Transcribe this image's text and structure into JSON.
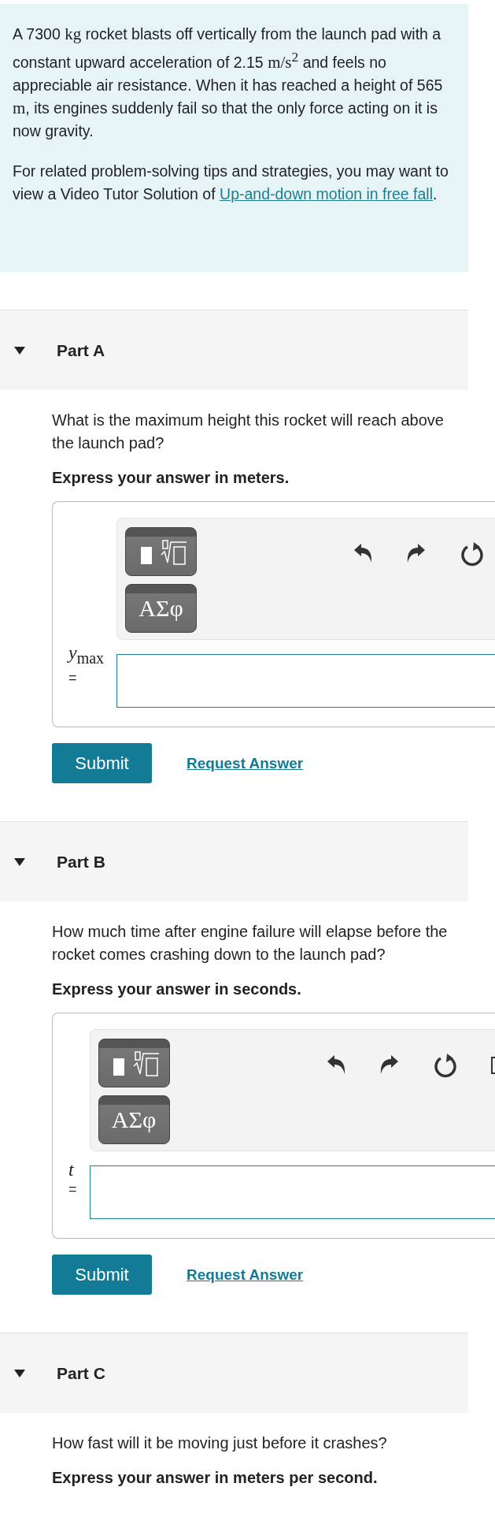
{
  "problem": {
    "paragraphs": [
      [
        {
          "kind": "text",
          "text": "A 7300 "
        },
        {
          "kind": "math",
          "text": "kg"
        },
        {
          "kind": "text",
          "text": " rocket blasts off vertically from the launch pad with a constant upward acceleration of 2.15 "
        },
        {
          "kind": "math",
          "text": "m/s$^{2}$"
        },
        {
          "kind": "text",
          "text": " and feels no appreciable air resistance. When it has reached a height of 565 "
        },
        {
          "kind": "math",
          "text": "m"
        },
        {
          "kind": "text",
          "text": ", its engines suddenly fail so that the only force acting on it is now gravity."
        }
      ],
      [
        {
          "kind": "text",
          "text": "For related problem-solving tips and strategies, you may want to view a Video Tutor Solution of "
        },
        {
          "kind": "link",
          "text": "Up-and-down motion in free fall"
        },
        {
          "kind": "text",
          "text": "."
        }
      ]
    ]
  },
  "parts": [
    {
      "title": "Part A",
      "expanded": true,
      "question": "What is the maximum height this rocket will reach above the launch pad?",
      "instruction": "Express your answer in meters.",
      "answer": {
        "label": "*y*$_{max}$",
        "equals": "=",
        "symbols_button": "ΑΣφ",
        "keyboard": false
      },
      "submit": "Submit",
      "request": "Request Answer"
    },
    {
      "title": "Part B",
      "expanded": true,
      "question": "How much time after engine failure will elapse before the rocket comes crashing down to the launch pad?",
      "instruction": "Express your answer in seconds.",
      "answer": {
        "label": "*t*",
        "equals": "=",
        "symbols_button": "ΑΣφ",
        "keyboard": true
      },
      "submit": "Submit",
      "request": "Request Answer"
    },
    {
      "title": "Part C",
      "expanded": true,
      "question": "How fast will it be moving just before it crashes?",
      "instruction": "Express your answer in meters per second."
    }
  ]
}
